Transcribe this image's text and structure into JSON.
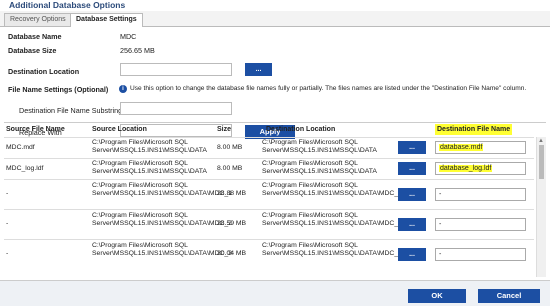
{
  "window": {
    "title": "Additional Database Options"
  },
  "tabs": [
    {
      "label": "Recovery Options"
    },
    {
      "label": "Database Settings"
    }
  ],
  "info": {
    "db_name_label": "Database Name",
    "db_name_value": "MDC",
    "db_size_label": "Database Size",
    "db_size_value": "256.65 MB"
  },
  "destination": {
    "label": "Destination Location",
    "value": "",
    "browse_label": "..."
  },
  "name_settings": {
    "label": "File Name Settings (Optional)",
    "hint": "Use this option to change the database file names fully or partially. The files names are listed under the \"Destination File Name\" column.",
    "substring_label": "Destination File Name Substring",
    "replace_label": "Replace With",
    "apply_label": "Apply"
  },
  "grid": {
    "headers": {
      "source_file": "Source File Name",
      "source_loc": "Source Location",
      "size": "Size",
      "dest_loc": "Destination Location",
      "dest_file": "Destination File Name"
    },
    "rows": [
      {
        "source_file": "MDC.mdf",
        "source_loc": "C:\\Program Files\\Microsoft SQL Server\\MSSQL15.INS1\\MSSQL\\DATA",
        "size": "8.00 MB",
        "dest_loc": "C:\\Program Files\\Microsoft SQL Server\\MSSQL15.INS1\\MSSQL\\DATA",
        "dest_file": "database.mdf"
      },
      {
        "source_file": "MDC_log.ldf",
        "source_loc": "C:\\Program Files\\Microsoft SQL Server\\MSSQL15.INS1\\MSSQL\\DATA",
        "size": "8.00 MB",
        "dest_loc": "C:\\Program Files\\Microsoft SQL Server\\MSSQL15.INS1\\MSSQL\\DATA",
        "dest_file": "database_log.ldf"
      },
      {
        "source_file": "-",
        "source_loc": "C:\\Program Files\\Microsoft SQL Server\\MSSQL15.INS1\\MSSQL\\DATA\\MDC_1",
        "size": "28.88 MB",
        "dest_loc": "C:\\Program Files\\Microsoft SQL Server\\MSSQL15.INS1\\MSSQL\\DATA\\MDC_1",
        "dest_file": "-"
      },
      {
        "source_file": "-",
        "source_loc": "C:\\Program Files\\Microsoft SQL Server\\MSSQL15.INS1\\MSSQL\\DATA\\MDC_2",
        "size": "28.59 MB",
        "dest_loc": "C:\\Program Files\\Microsoft SQL Server\\MSSQL15.INS1\\MSSQL\\DATA\\MDC_2",
        "dest_file": "-"
      },
      {
        "source_file": "-",
        "source_loc": "C:\\Program Files\\Microsoft SQL Server\\MSSQL15.INS1\\MSSQL\\DATA\\MDC_3",
        "size": "30.04 MB",
        "dest_loc": "C:\\Program Files\\Microsoft SQL Server\\MSSQL15.INS1\\MSSQL\\DATA\\MDC_3",
        "dest_file": "-"
      }
    ],
    "browse_label": "..."
  },
  "footer": {
    "ok_label": "OK",
    "cancel_label": "Cancel"
  },
  "colors": {
    "accent": "#1c4fa3",
    "highlight": "#ffff33"
  }
}
